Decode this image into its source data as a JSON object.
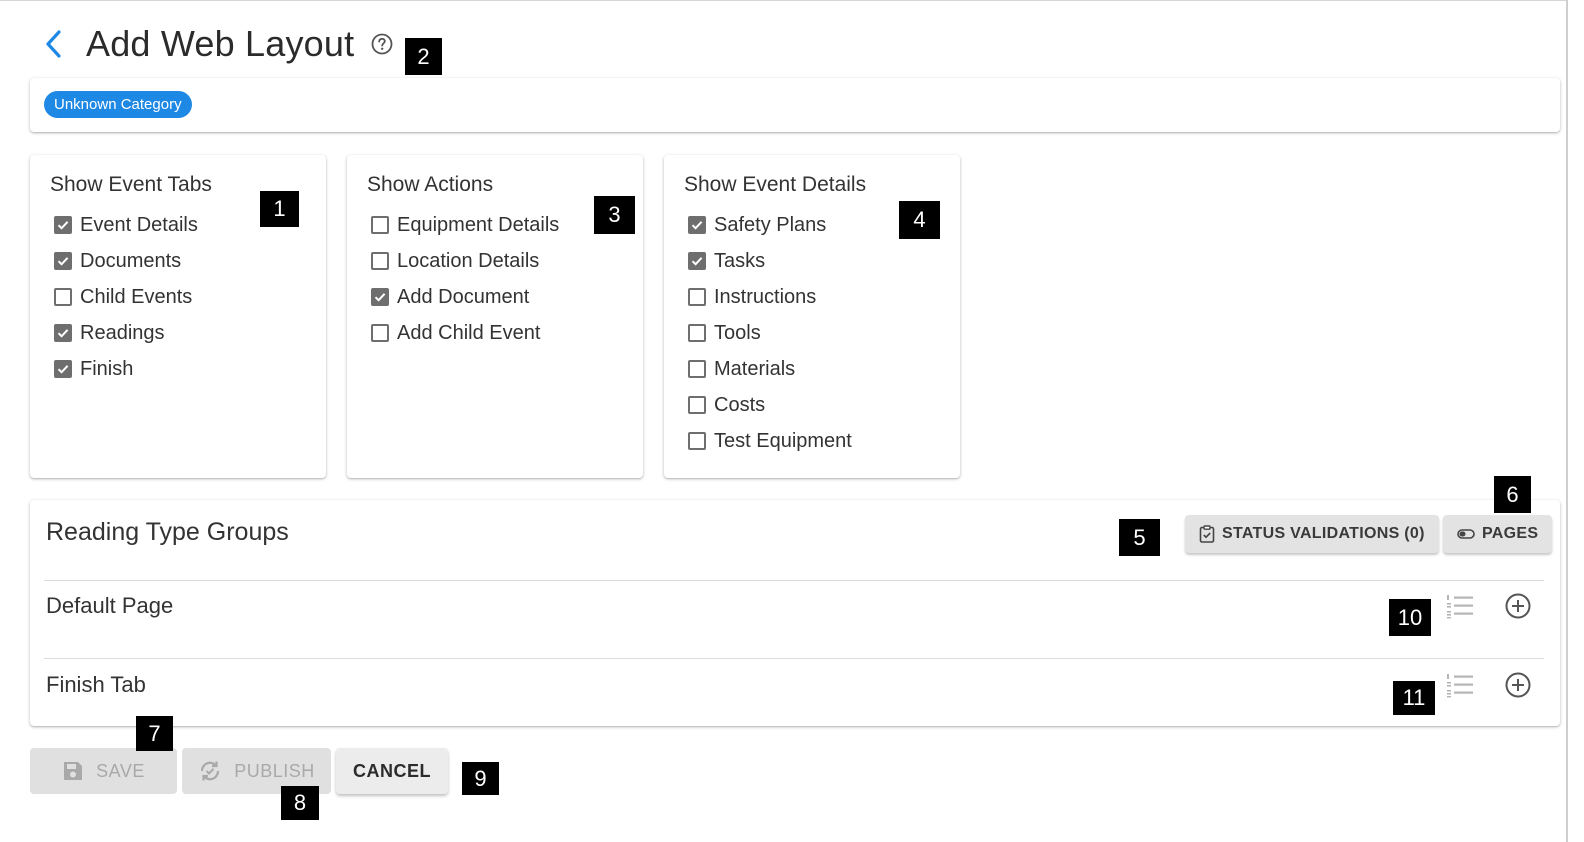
{
  "header": {
    "title": "Add Web Layout",
    "back_icon": "chevron-left-icon",
    "help_icon": "help-circle-icon"
  },
  "category": {
    "chip_label": "Unknown Category",
    "chip_color": "#1e88e5"
  },
  "panels": [
    {
      "title": "Show Event Tabs",
      "items": [
        {
          "label": "Event Details",
          "checked": true
        },
        {
          "label": "Documents",
          "checked": true
        },
        {
          "label": "Child Events",
          "checked": false
        },
        {
          "label": "Readings",
          "checked": true
        },
        {
          "label": "Finish",
          "checked": true
        }
      ]
    },
    {
      "title": "Show Actions",
      "items": [
        {
          "label": "Equipment Details",
          "checked": false
        },
        {
          "label": "Location Details",
          "checked": false
        },
        {
          "label": "Add Document",
          "checked": true
        },
        {
          "label": "Add Child Event",
          "checked": false
        }
      ]
    },
    {
      "title": "Show Event Details",
      "items": [
        {
          "label": "Safety Plans",
          "checked": true
        },
        {
          "label": "Tasks",
          "checked": true
        },
        {
          "label": "Instructions",
          "checked": false
        },
        {
          "label": "Tools",
          "checked": false
        },
        {
          "label": "Materials",
          "checked": false
        },
        {
          "label": "Costs",
          "checked": false
        },
        {
          "label": "Test Equipment",
          "checked": false
        }
      ]
    }
  ],
  "reading_type_groups": {
    "title": "Reading Type Groups",
    "status_validations_label": "STATUS VALIDATIONS (0)",
    "pages_label": "PAGES",
    "rows": [
      {
        "label": "Default Page"
      },
      {
        "label": "Finish Tab"
      }
    ]
  },
  "footer": {
    "save_label": "SAVE",
    "publish_label": "PUBLISH",
    "cancel_label": "CANCEL"
  },
  "markers": [
    "1",
    "2",
    "3",
    "4",
    "5",
    "6",
    "7",
    "8",
    "9",
    "10",
    "11"
  ],
  "colors": {
    "accent": "#1e88e5",
    "checkbox": "#6e6e6e",
    "disabled_bg": "#e0e0e0"
  }
}
